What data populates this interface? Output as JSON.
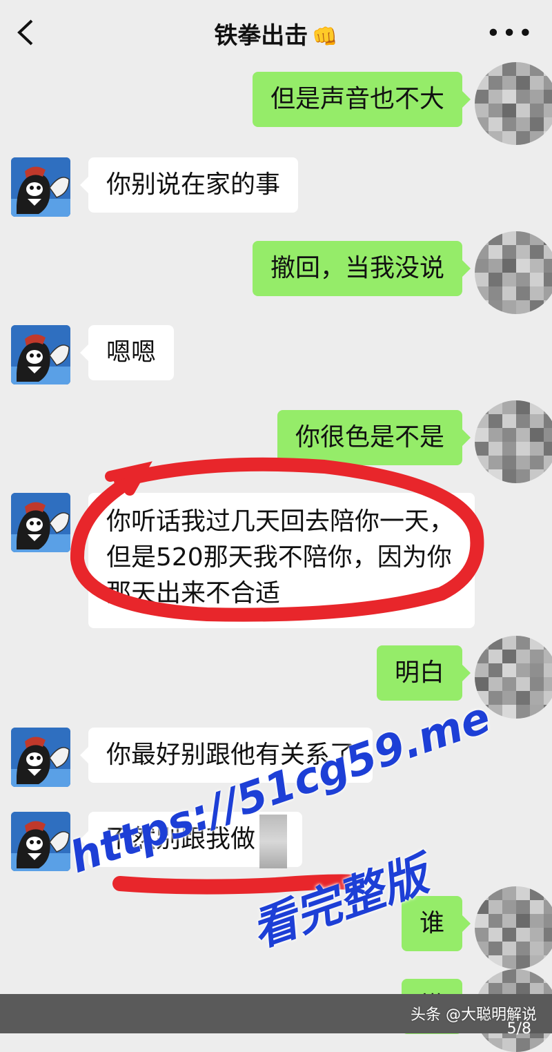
{
  "header": {
    "title": "铁拳出击",
    "title_emoji": "👊",
    "more_label": "•••"
  },
  "messages": [
    {
      "side": "right",
      "text": "但是声音也不大"
    },
    {
      "side": "left",
      "text": "你别说在家的事"
    },
    {
      "side": "right",
      "text": "撤回，当我没说"
    },
    {
      "side": "left",
      "text": "嗯嗯"
    },
    {
      "side": "right",
      "text": "你很色是不是"
    },
    {
      "side": "left",
      "lines": [
        "你听话我过几天回去陪你一天，",
        "但是520那天我不陪你，因为你",
        "那天出来不合适"
      ]
    },
    {
      "side": "right",
      "text": "明白"
    },
    {
      "side": "left",
      "text": "你最好别跟他有关系了"
    },
    {
      "side": "left",
      "text": "不然别跟我做"
    },
    {
      "side": "right",
      "text": "谁"
    },
    {
      "side": "right",
      "text": "懂"
    }
  ],
  "watermark": {
    "url": "https://51cg59.me",
    "caption": "看完整版"
  },
  "footer": {
    "source": "头条 @大聪明解说",
    "page": "5/8"
  },
  "colors": {
    "background": "#ededed",
    "own_bubble": "#95ec69",
    "other_bubble": "#ffffff",
    "annotation_red": "#e8262b",
    "watermark_blue": "#1d3fd6"
  }
}
